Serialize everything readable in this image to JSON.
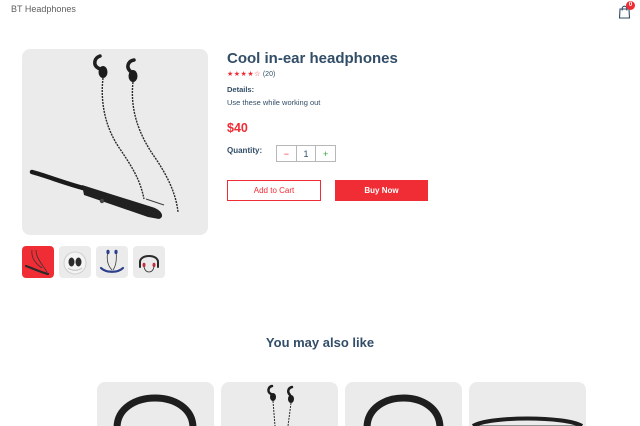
{
  "navbar": {
    "logo": "BT Headphones",
    "cart_count": "0"
  },
  "product": {
    "title": "Cool in-ear headphones",
    "stars": "★★★★☆",
    "review_count": "(20)",
    "details_heading": "Details:",
    "details_text": "Use these while working out",
    "price": "$40",
    "quantity_label": "Quantity:",
    "quantity_value": "1",
    "minus": "−",
    "plus": "+",
    "add_to_cart": "Add to Cart",
    "buy_now": "Buy Now"
  },
  "colors": {
    "accent": "#f02d34",
    "text": "#324d67",
    "image_bg": "#ebebeb"
  },
  "related": {
    "heading": "You may also like"
  }
}
